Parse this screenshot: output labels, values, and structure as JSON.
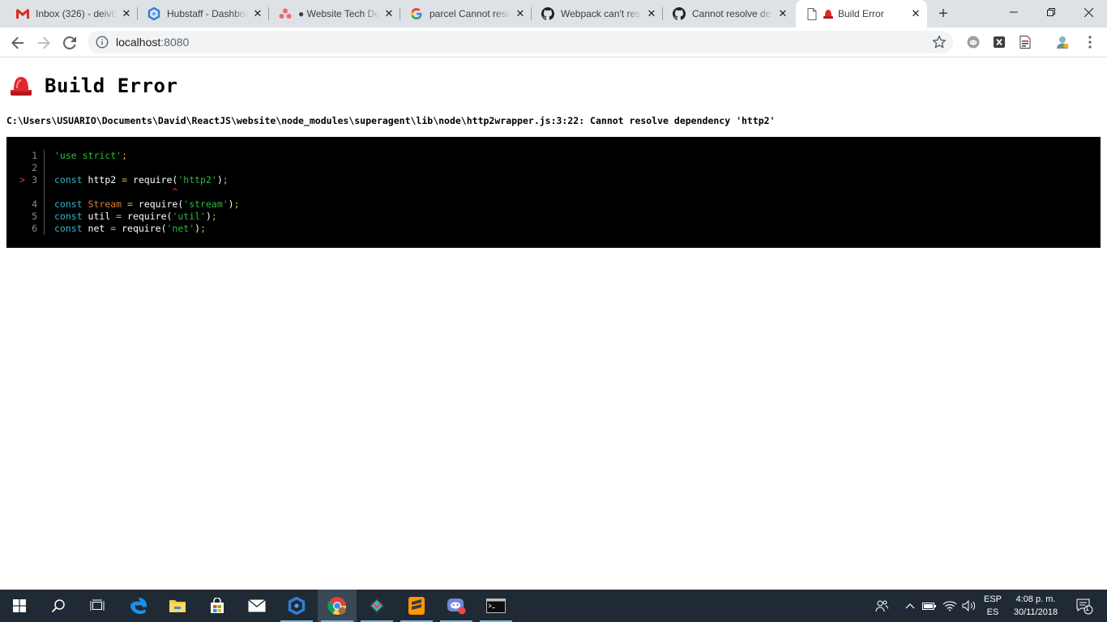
{
  "browser": {
    "tabs": [
      {
        "title": "Inbox (326) - deivb",
        "icon": "gmail-icon"
      },
      {
        "title": "Hubstaff - Dashboard",
        "icon": "hubstaff-icon"
      },
      {
        "title": "● Website Tech De",
        "icon": "asana-icon"
      },
      {
        "title": "parcel Cannot reso",
        "icon": "google-icon"
      },
      {
        "title": "Webpack can't res",
        "icon": "github-icon"
      },
      {
        "title": "Cannot resolve de",
        "icon": "github-icon"
      },
      {
        "title": "Build Error",
        "icon": "siren-icon",
        "active": true
      }
    ],
    "new_tab": "+",
    "window_controls": {
      "minimize": "—",
      "maximize": "❐",
      "close": "✕"
    },
    "address": {
      "host": "localhost",
      "port": ":8080"
    }
  },
  "page": {
    "heading": "Build Error",
    "message": "C:\\Users\\USUARIO\\Documents\\David\\ReactJS\\website\\node_modules\\superagent\\lib\\node\\http2wrapper.js:3:22: Cannot resolve dependency 'http2'",
    "code_frame": {
      "lines": [
        {
          "num": "1",
          "marked": false,
          "tokens": [
            {
              "t": "'use strict'",
              "c": "str"
            },
            {
              "t": ";",
              "c": "pun"
            }
          ]
        },
        {
          "num": "2",
          "marked": false,
          "tokens": []
        },
        {
          "num": "3",
          "marked": true,
          "tokens": [
            {
              "t": "const",
              "c": "kw"
            },
            {
              "t": " http2 ",
              "c": "id"
            },
            {
              "t": "=",
              "c": "pun"
            },
            {
              "t": " require(",
              "c": "id"
            },
            {
              "t": "'http2'",
              "c": "str"
            },
            {
              "t": ")",
              "c": "id"
            },
            {
              "t": ";",
              "c": "pun"
            }
          ]
        },
        {
          "num": "",
          "marked": false,
          "caret": true,
          "tokens": [
            {
              "t": "                     ^",
              "c": "caret"
            }
          ]
        },
        {
          "num": "4",
          "marked": false,
          "tokens": [
            {
              "t": "const",
              "c": "kw"
            },
            {
              "t": " Stream",
              "c": "var"
            },
            {
              "t": " ",
              "c": "id"
            },
            {
              "t": "=",
              "c": "pun"
            },
            {
              "t": " require(",
              "c": "id"
            },
            {
              "t": "'stream'",
              "c": "str"
            },
            {
              "t": ")",
              "c": "id"
            },
            {
              "t": ";",
              "c": "pun"
            }
          ]
        },
        {
          "num": "5",
          "marked": false,
          "tokens": [
            {
              "t": "const",
              "c": "kw"
            },
            {
              "t": " util ",
              "c": "id"
            },
            {
              "t": "=",
              "c": "pun"
            },
            {
              "t": " require(",
              "c": "id"
            },
            {
              "t": "'util'",
              "c": "str"
            },
            {
              "t": ")",
              "c": "id"
            },
            {
              "t": ";",
              "c": "pun"
            }
          ]
        },
        {
          "num": "6",
          "marked": false,
          "tokens": [
            {
              "t": "const",
              "c": "kw"
            },
            {
              "t": " net ",
              "c": "id"
            },
            {
              "t": "=",
              "c": "pun"
            },
            {
              "t": " require(",
              "c": "id"
            },
            {
              "t": "'net'",
              "c": "str"
            },
            {
              "t": ")",
              "c": "id"
            },
            {
              "t": ";",
              "c": "pun"
            }
          ]
        }
      ],
      "marker": ">"
    }
  },
  "taskbar": {
    "apps": [
      "start-icon",
      "search-icon",
      "task-view-icon",
      "edge-icon",
      "file-explorer-icon",
      "store-icon",
      "mail-icon",
      "hubstaff-icon",
      "chrome-icon",
      "gitkraken-icon",
      "sublime-icon",
      "discord-icon",
      "terminal-icon"
    ],
    "lang_top": "ESP",
    "lang_bottom": "ES",
    "time": "4:08 p. m.",
    "date": "30/11/2018",
    "notification_count": "1"
  },
  "colors": {
    "tabstrip": "#dee1e6",
    "code_bg": "#000000",
    "keyword": "#32b8c4",
    "string": "#2eb843",
    "marker": "#e23b3b",
    "taskbar": "#1f2a35"
  }
}
